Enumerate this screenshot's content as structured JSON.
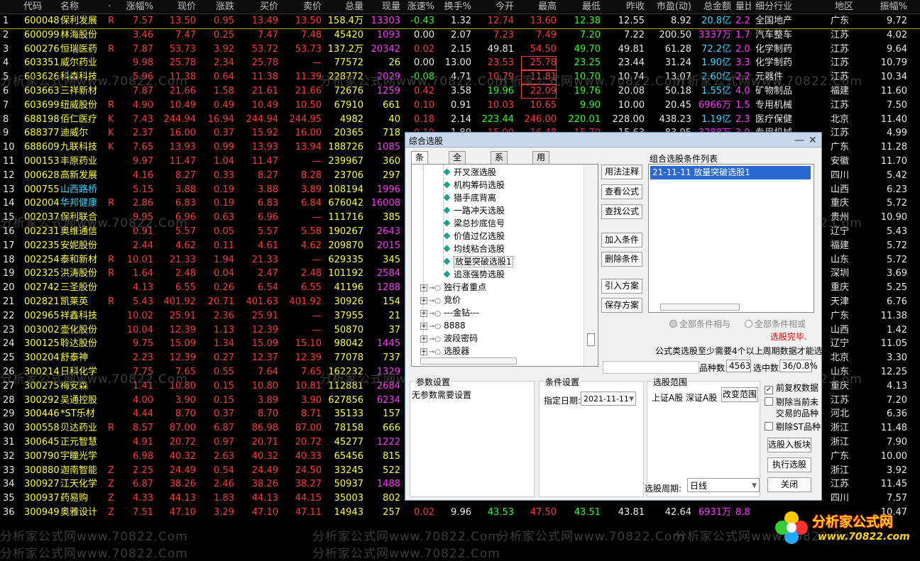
{
  "columns": [
    "代码",
    "名称",
    "·",
    "涨幅%",
    "现价",
    "涨跌",
    "买价",
    "卖价",
    "总量",
    "现量",
    "涨速%",
    "换手%",
    "今开",
    "最高",
    "最低",
    "昨收",
    "市盈(动)",
    "总金额",
    "量比",
    "细分行业",
    "地区",
    "振幅%"
  ],
  "rows": [
    [
      "1",
      "600048",
      "保利发展",
      "R",
      "7.57",
      "13.50",
      "0.95",
      "13.49",
      "13.50",
      "158.4万",
      "13303",
      "-0.43",
      "1.32",
      "12.74",
      "13.60",
      "12.38",
      "12.55",
      "8.92",
      "20.8亿",
      "2.21",
      "全国地产",
      "广东",
      "9.72"
    ],
    [
      "2",
      "600099",
      "林海股份",
      "",
      "3.46",
      "7.47",
      "0.25",
      "7.47",
      "7.48",
      "45420",
      "1093",
      "0.00",
      "2.07",
      "7.23",
      "7.49",
      "7.20",
      "7.22",
      "200.50",
      "3337万",
      "1.70",
      "汽车整车",
      "江苏",
      "4.02"
    ],
    [
      "3",
      "600276",
      "恒瑞医药",
      "R",
      "7.87",
      "53.73",
      "3.92",
      "53.72",
      "53.73",
      "137.2万",
      "20342",
      "0.02",
      "2.15",
      "49.81",
      "54.50",
      "49.70",
      "49.81",
      "61.28",
      "72.2亿",
      "2.04",
      "化学制药",
      "江苏",
      "9.64"
    ],
    [
      "4",
      "603351",
      "威尔药业",
      "",
      "9.98",
      "25.78",
      "2.34",
      "25.78",
      "—",
      "77572",
      "26",
      "0.00",
      "13.00",
      "23.53",
      "25.78",
      "23.25",
      "23.44",
      "31.24",
      "1.90亿",
      "3.30",
      "化学制药",
      "江苏",
      "10.79"
    ],
    [
      "5",
      "603626",
      "科森科技",
      "",
      "5.96",
      "11.38",
      "0.64",
      "11.38",
      "11.39",
      "228772",
      "2029",
      "-0.08",
      "4.71",
      "10.79",
      "11.81",
      "10.70",
      "10.74",
      "13.07",
      "2.60亿",
      "2.29",
      "元器件",
      "江苏",
      "10.34"
    ],
    [
      "6",
      "603663",
      "三祥新材",
      "",
      "7.87",
      "21.66",
      "1.58",
      "21.61",
      "21.66",
      "72676",
      "1259",
      "0.42",
      "3.58",
      "19.96",
      "22.09",
      "19.76",
      "20.08",
      "50.18",
      "1.55亿",
      "4.04",
      "矿物制品",
      "福建",
      "11.60"
    ],
    [
      "7",
      "603699",
      "纽威股份",
      "R",
      "4.90",
      "10.49",
      "0.49",
      "10.49",
      "10.50",
      "67910",
      "661",
      "0.10",
      "0.91",
      "10.03",
      "10.65",
      "9.90",
      "10.00",
      "20.45",
      "6966万",
      "1.55",
      "专用机械",
      "江苏",
      "7.50"
    ],
    [
      "8",
      "688198",
      "佰仁医疗",
      "K",
      "7.43",
      "244.94",
      "16.94",
      "244.94",
      "244.95",
      "4982",
      "40",
      "0.18",
      "2.14",
      "223.44",
      "246.00",
      "220.01",
      "228.00",
      "438.23",
      "1.19亿",
      "2.31",
      "医疗保健",
      "北京",
      "11.40"
    ],
    [
      "9",
      "688377",
      "迪威尔",
      "K",
      "2.37",
      "16.00",
      "0.37",
      "15.92",
      "16.00",
      "20365",
      "718",
      "0.19",
      "1.89",
      "15.90",
      "16.48",
      "15.70",
      "15.63",
      "83.95",
      "3288万",
      "3.96",
      "专用机械",
      "江苏",
      "4.99"
    ],
    [
      "10",
      "688609",
      "九联科技",
      "K",
      "7.65",
      "13.93",
      "0.99",
      "13.93",
      "13.94",
      "188726",
      "1085",
      "",
      "",
      "",
      "",
      "",
      "",
      "",
      "",
      "",
      "",
      "广东",
      "11.28"
    ],
    [
      "11",
      "000153",
      "丰原药业",
      "",
      "9.97",
      "11.47",
      "1.04",
      "11.47",
      "—",
      "239967",
      "360",
      "",
      "",
      "",
      "",
      "",
      "",
      "",
      "",
      "",
      "",
      "安徽",
      "11.70"
    ],
    [
      "12",
      "000628",
      "高新发展",
      "",
      "4.16",
      "8.27",
      "0.33",
      "8.27",
      "8.28",
      "23706",
      "297",
      "",
      "",
      "",
      "",
      "",
      "",
      "",
      "",
      "",
      "",
      "四川",
      "5.42"
    ],
    [
      "13",
      "000755",
      "山西路桥",
      "",
      "5.15",
      "3.88",
      "0.19",
      "3.88",
      "3.89",
      "108194",
      "1996",
      "",
      "",
      "",
      "",
      "",
      "",
      "",
      "",
      "",
      "",
      "山西",
      "6.23"
    ],
    [
      "14",
      "002004",
      "华邦健康",
      "R",
      "2.86",
      "6.83",
      "0.19",
      "6.83",
      "6.84",
      "676042",
      "16008",
      "",
      "",
      "",
      "",
      "",
      "",
      "",
      "",
      "",
      "",
      "重庆",
      "5.72"
    ],
    [
      "15",
      "002037",
      "保利联合",
      "",
      "9.95",
      "6.96",
      "0.63",
      "6.96",
      "—",
      "111716",
      "385",
      "",
      "",
      "",
      "",
      "",
      "",
      "",
      "",
      "",
      "",
      "贵州",
      "10.90"
    ],
    [
      "16",
      "002231",
      "奥维通信",
      "",
      "0.91",
      "5.57",
      "0.05",
      "5.57",
      "5.58",
      "190267",
      "2643",
      "",
      "",
      "",
      "",
      "",
      "",
      "",
      "",
      "",
      "",
      "辽宁",
      "5.43"
    ],
    [
      "17",
      "002235",
      "安妮股份",
      "",
      "2.44",
      "4.62",
      "0.11",
      "4.61",
      "4.62",
      "209870",
      "2015",
      "",
      "",
      "",
      "",
      "",
      "",
      "",
      "",
      "",
      "",
      "福建",
      "5.72"
    ],
    [
      "18",
      "002254",
      "泰和新材",
      "R",
      "10.01",
      "21.33",
      "1.94",
      "21.33",
      "—",
      "629335",
      "345",
      "",
      "",
      "",
      "",
      "",
      "",
      "",
      "",
      "",
      "",
      "山东",
      "5.72"
    ],
    [
      "19",
      "002325",
      "洪涛股份",
      "R",
      "1.64",
      "2.48",
      "0.04",
      "2.47",
      "2.48",
      "101192",
      "2584",
      "",
      "",
      "",
      "",
      "",
      "",
      "",
      "",
      "",
      "",
      "深圳",
      "3.69"
    ],
    [
      "20",
      "002742",
      "三圣股份",
      "",
      "4.13",
      "6.55",
      "0.26",
      "6.54",
      "6.55",
      "41196",
      "1288",
      "",
      "",
      "",
      "",
      "",
      "",
      "",
      "",
      "",
      "",
      "重庆",
      "5.25"
    ],
    [
      "21",
      "002821",
      "凯莱英",
      "R",
      "5.43",
      "401.92",
      "20.71",
      "401.63",
      "401.92",
      "30926",
      "154",
      "",
      "",
      "",
      "",
      "",
      "",
      "",
      "",
      "",
      "",
      "天津",
      "6.76"
    ],
    [
      "22",
      "002965",
      "祥鑫科技",
      "",
      "10.02",
      "25.91",
      "2.36",
      "25.91",
      "—",
      "37955",
      "21",
      "",
      "",
      "",
      "",
      "",
      "",
      "",
      "",
      "",
      "",
      "广东",
      "11.38"
    ],
    [
      "23",
      "003002",
      "壶化股份",
      "",
      "10.04",
      "12.39",
      "1.13",
      "12.39",
      "—",
      "50870",
      "37",
      "",
      "",
      "",
      "",
      "",
      "",
      "",
      "",
      "",
      "",
      "山西",
      "1.42"
    ],
    [
      "24",
      "300125",
      "聆达股份",
      "",
      "9.75",
      "15.09",
      "1.34",
      "15.09",
      "15.10",
      "98042",
      "1445",
      "",
      "",
      "",
      "",
      "",
      "",
      "",
      "",
      "",
      "",
      "辽宁",
      "11.05"
    ],
    [
      "25",
      "300204",
      "舒泰神",
      "",
      "2.23",
      "12.39",
      "0.27",
      "12.37",
      "12.39",
      "77078",
      "737",
      "",
      "",
      "",
      "",
      "",
      "",
      "",
      "",
      "",
      "",
      "北京",
      "3.30"
    ],
    [
      "26",
      "300214",
      "日科化学",
      "",
      "7.75",
      "7.65",
      "0.55",
      "7.64",
      "7.65",
      "162232",
      "1329",
      "",
      "",
      "",
      "",
      "",
      "",
      "",
      "",
      "",
      "",
      "山东",
      "12.25"
    ],
    [
      "27",
      "300275",
      "梅安森",
      "",
      "1.41",
      "10.80",
      "0.15",
      "10.80",
      "10.81",
      "112881",
      "2684",
      "",
      "",
      "",
      "",
      "",
      "",
      "",
      "",
      "",
      "",
      "重庆",
      "4.13"
    ],
    [
      "28",
      "300292",
      "吴通控股",
      "",
      "4.00",
      "3.90",
      "0.15",
      "3.89",
      "3.90",
      "627856",
      "6234",
      "",
      "",
      "",
      "",
      "",
      "",
      "",
      "",
      "",
      "",
      "江苏",
      "7.20"
    ],
    [
      "29",
      "300446",
      "*ST乐材",
      "",
      "4.44",
      "8.70",
      "0.37",
      "8.70",
      "8.71",
      "35133",
      "157",
      "",
      "",
      "",
      "",
      "",
      "",
      "",
      "",
      "",
      "",
      "河北",
      "6.36"
    ],
    [
      "30",
      "300558",
      "贝达药业",
      "R",
      "8.57",
      "87.00",
      "6.87",
      "86.98",
      "87.00",
      "78158",
      "666",
      "",
      "",
      "",
      "",
      "",
      "",
      "",
      "",
      "",
      "",
      "浙江",
      "11.48"
    ],
    [
      "31",
      "300645",
      "正元智慧",
      "",
      "4.91",
      "20.72",
      "0.97",
      "20.71",
      "20.72",
      "45277",
      "1222",
      "",
      "",
      "",
      "",
      "",
      "",
      "",
      "",
      "",
      "",
      "浙江",
      "7.90"
    ],
    [
      "32",
      "300790",
      "宇瞳光学",
      "",
      "6.98",
      "40.32",
      "2.63",
      "40.32",
      "40.33",
      "65456",
      "815",
      "",
      "",
      "",
      "",
      "",
      "",
      "",
      "",
      "",
      "",
      "广东",
      "10.00"
    ],
    [
      "33",
      "300880",
      "迦南智能",
      "Z",
      "2.25",
      "24.49",
      "0.54",
      "24.49",
      "24.50",
      "33245",
      "522",
      "",
      "",
      "",
      "",
      "",
      "",
      "",
      "",
      "",
      "",
      "浙江",
      "3.92"
    ],
    [
      "34",
      "300927",
      "江天化学",
      "Z",
      "6.87",
      "38.26",
      "2.46",
      "38.26",
      "38.27",
      "50937",
      "1488",
      "",
      "",
      "",
      "",
      "",
      "",
      "",
      "",
      "",
      "",
      "江苏",
      "11.45"
    ],
    [
      "35",
      "300937",
      "药易购",
      "Z",
      "4.33",
      "44.13",
      "1.83",
      "44.13",
      "44.15",
      "35003",
      "802",
      "",
      "",
      "",
      "",
      "",
      "",
      "",
      "",
      "",
      "",
      "四川",
      "7.57"
    ],
    [
      "36",
      "300949",
      "奥雅设计",
      "Z",
      "7.51",
      "47.10",
      "3.29",
      "47.10",
      "47.11",
      "14943",
      "257",
      "0.02",
      "9.96",
      "43.53",
      "47.50",
      "43.51",
      "43.81",
      "42.64",
      "6931万",
      "8.89",
      "",
      "",
      "10.47"
    ]
  ],
  "watermark_text": "分析家公式网www.70822.Com",
  "logo": {
    "line1": "分析家公式网",
    "line2": "www.70822.com"
  },
  "dialog": {
    "title": "综合选股",
    "tabs": [
      "条件组",
      "全部条件",
      "系统条件",
      "用户条件"
    ],
    "tree_items": [
      "开叉涨选股",
      "机构筹码选股",
      "猎手底背离",
      "一路冲天选股",
      "梁总抄底信号",
      "价值过亿选股",
      "均线粘合选股",
      "放量突破选股1",
      "追涨强势选股"
    ],
    "tree_groups": [
      "独行者重点",
      "竞价",
      "---金钻---",
      "8888",
      "波段密码",
      "选股器"
    ],
    "buttons_mid": [
      "用法注释",
      "查看公式",
      "查找公式",
      "加入条件",
      "删除条件",
      "引入方案",
      "保存方案"
    ],
    "list_title": "组合选股条件列表",
    "list_items": [
      "21-11-11 放量突破选股1"
    ],
    "radio_and": "全部条件相与",
    "radio_or": "全部条件相或",
    "status": "选股完毕.",
    "note": "公式类选股至少需要4个以上周期数据才能选出",
    "count_label": "品种数",
    "count_value": "4563",
    "selected_label": "选中数",
    "selected_value": "36/0.8%",
    "param_group": "参数设置",
    "param_text": "无参数需要设置",
    "cond_group": "条件设置",
    "date_label": "指定日期:",
    "date_value": "2021-11-11",
    "range_group": "选股范围",
    "range_text": "上证A股 深证A股",
    "change_range": "改变范围",
    "chk1": "前复权数据",
    "chk2a": "剔除当前未",
    "chk2b": "交易的品种",
    "chk3": "剔除ST品种",
    "btn_block": "选股入板块",
    "btn_exec": "执行选股",
    "btn_close": "关闭",
    "period_label": "选股周期:",
    "period_value": "日线"
  }
}
